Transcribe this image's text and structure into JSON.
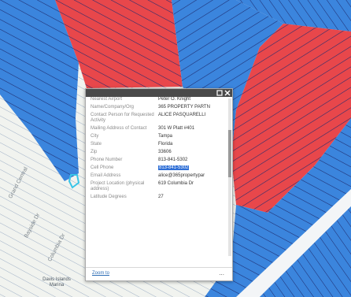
{
  "map": {
    "colors": {
      "background": "#e8ede4",
      "water_blue": "#3b85dd",
      "parcel_red": "#e8474b",
      "hatch_line": "#1e2a6e",
      "road": "#ffffff",
      "selection": "#39c5e8"
    },
    "street_labels": [
      "Bayside Dr",
      "Grand Central",
      "Columbia Dr"
    ],
    "poi_label": "Davis Islands Marina"
  },
  "popup": {
    "header_controls": [
      "maximize-icon",
      "close-icon"
    ],
    "rows": [
      {
        "key": "Nearest Airport",
        "value": "Peter O. Knight"
      },
      {
        "key": "Name/Company/Org",
        "value": "365 PROPERTY PARTN"
      },
      {
        "key": "Contact Person for Requested Activity",
        "value": "ALICE PASQUARELLI"
      },
      {
        "key": "Mailing Address of Contact",
        "value": "301 W Platt #401"
      },
      {
        "key": "City",
        "value": "Tampa"
      },
      {
        "key": "State",
        "value": "Florida"
      },
      {
        "key": "Zip",
        "value": "33606"
      },
      {
        "key": "Phone Number",
        "value": "813-841-5302"
      },
      {
        "key": "Cell Phone",
        "value": "813-841-5302"
      },
      {
        "key": "Email Address",
        "value": "alice@365propertypar"
      },
      {
        "key": "Project Location (physical address)",
        "value": "619 Columbia Dr"
      },
      {
        "key": "Latitude Degrees",
        "value": "27"
      }
    ],
    "selected_row_index": 8,
    "footer": {
      "zoom_link": "Zoom to",
      "more": "..."
    }
  }
}
